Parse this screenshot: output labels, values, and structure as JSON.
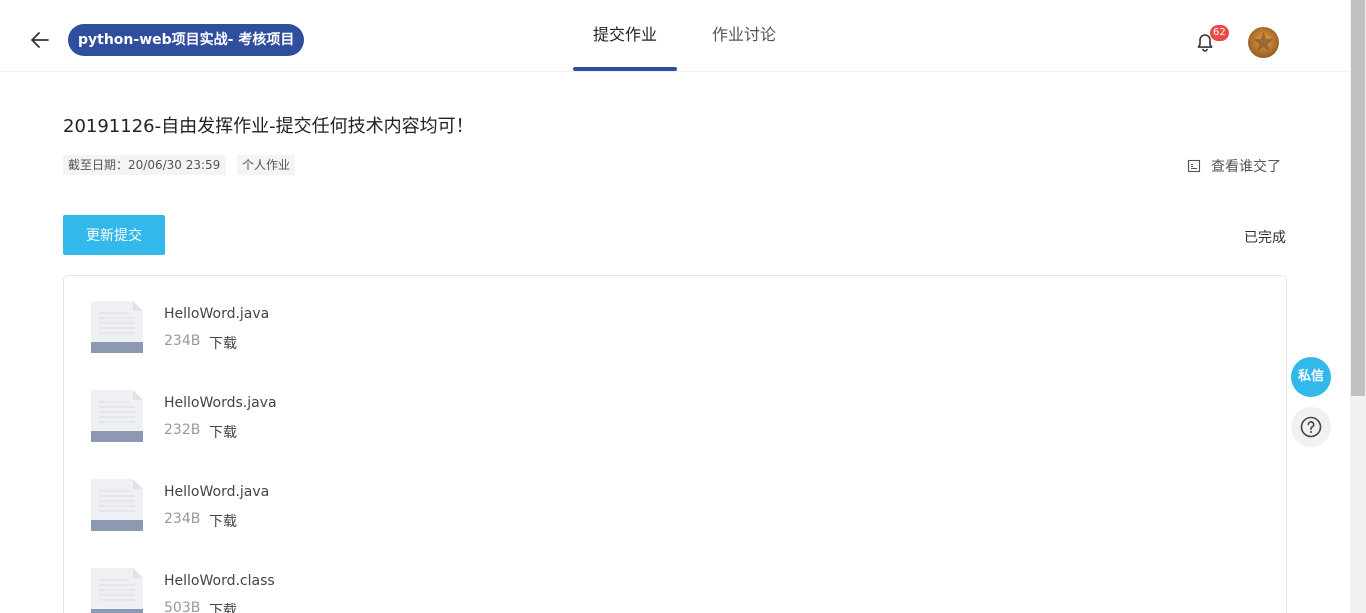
{
  "header": {
    "course_title": "python-web项目实战- 考核项目",
    "tabs": [
      {
        "label": "提交作业",
        "active": true
      },
      {
        "label": "作业讨论",
        "active": false
      }
    ],
    "notification_count": "62"
  },
  "assignment": {
    "title": "20191126-自由发挥作业-提交任何技术内容均可！",
    "deadline": "截至日期：20/06/30  23:59",
    "type_tag": "个人作业",
    "who_submitted_label": "查看谁交了",
    "update_button_label": "更新提交",
    "status": "已完成"
  },
  "files": [
    {
      "name": "HelloWord.java",
      "size": "234B",
      "download_label": "下载"
    },
    {
      "name": "HelloWords.java",
      "size": "232B",
      "download_label": "下载"
    },
    {
      "name": "HelloWord.java",
      "size": "234B",
      "download_label": "下载"
    },
    {
      "name": "HelloWord.class",
      "size": "503B",
      "download_label": "下载"
    }
  ],
  "floating": {
    "message_label": "私信"
  },
  "colors": {
    "brand": "#2f4f9e",
    "accent": "#33b8ec",
    "badge": "#ea4a46"
  }
}
